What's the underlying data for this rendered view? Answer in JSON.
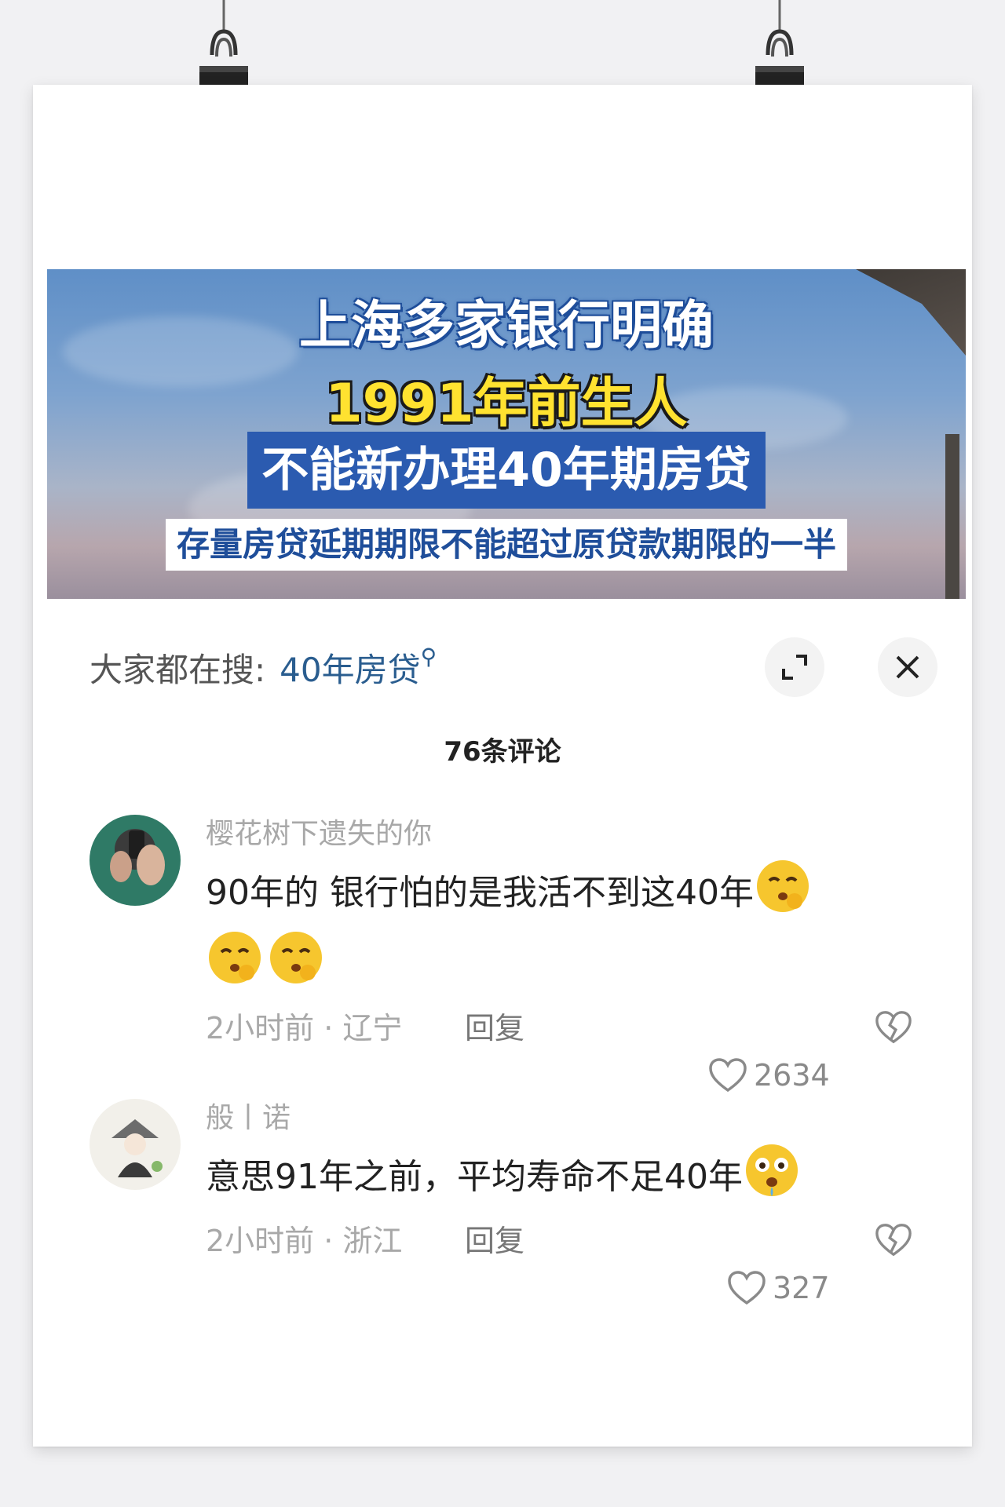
{
  "banner": {
    "line1": "上海多家银行明确",
    "line2": "1991年前生人",
    "line3": "不能新办理40年期房贷",
    "line4": "存量房贷延期期限不能超过原贷款期限的一半"
  },
  "search": {
    "prefix": "大家都在搜:",
    "keyword": "40年房贷"
  },
  "comments_count": "76条评论",
  "comments": [
    {
      "user": "樱花树下遗失的你",
      "text": "90年的  银行怕的是我活不到这40年",
      "time_location": "2小时前 · 辽宁",
      "reply_label": "回复",
      "likes": "2634"
    },
    {
      "user": "般丨诺",
      "text": "意思91年之前，平均寿命不足40年",
      "time_location": "2小时前 · 浙江",
      "reply_label": "回复",
      "likes": "327"
    }
  ]
}
